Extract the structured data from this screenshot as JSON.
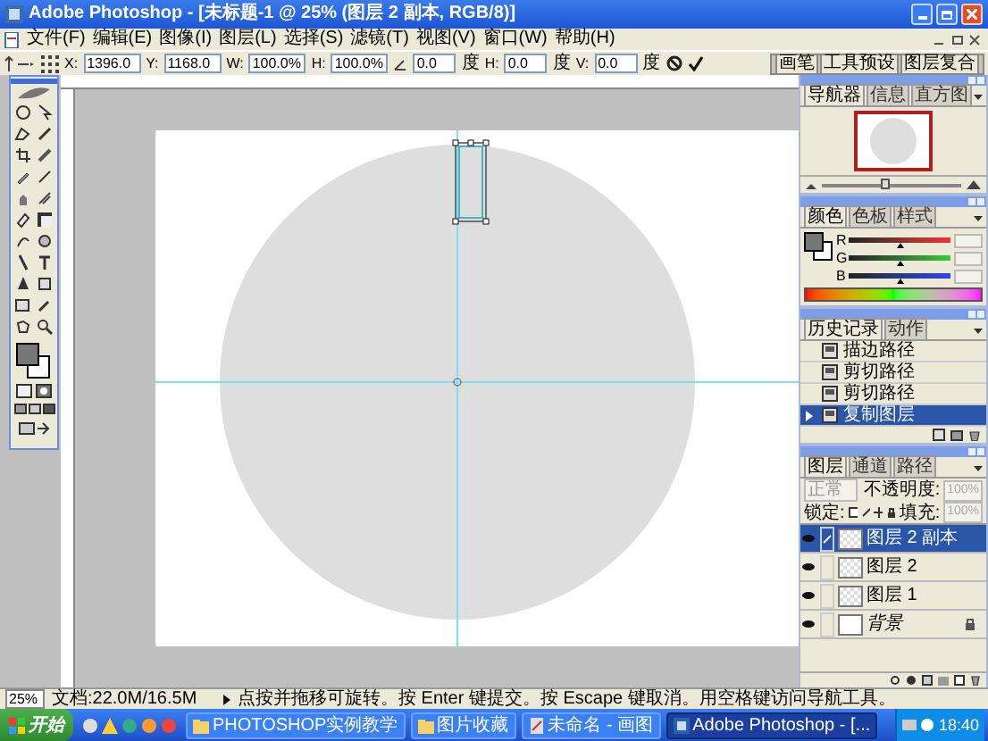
{
  "window": {
    "title": "Adobe Photoshop - [未标题-1 @ 25% (图层 2 副本, RGB/8)]"
  },
  "menu": [
    "文件(F)",
    "编辑(E)",
    "图像(I)",
    "图层(L)",
    "选择(S)",
    "滤镜(T)",
    "视图(V)",
    "窗口(W)",
    "帮助(H)"
  ],
  "options_bar": {
    "fields": [
      {
        "label": "X:",
        "value": "1396.0"
      },
      {
        "label": "Y:",
        "value": "1168.0"
      },
      {
        "label": "W:",
        "value": "100.0%"
      },
      {
        "label": "H:",
        "value": "100.0%"
      },
      {
        "value": "0.0",
        "unit": "度"
      },
      {
        "label": "H:",
        "value": "0.0",
        "unit": "度"
      },
      {
        "label": "V:",
        "value": "0.0",
        "unit": "度"
      }
    ],
    "palette_well_tabs": [
      "画笔",
      "工具预设",
      "图层复合"
    ]
  },
  "navigator": {
    "tabs": [
      {
        "label": "导航器",
        "selected": true
      },
      {
        "label": "信息",
        "selected": false
      },
      {
        "label": "直方图",
        "selected": false
      }
    ],
    "zoom_slider": {
      "level": 0.45
    }
  },
  "color": {
    "tabs": [
      {
        "label": "颜色",
        "selected": true
      },
      {
        "label": "色板",
        "selected": false
      },
      {
        "label": "样式",
        "selected": false
      }
    ],
    "channels": [
      {
        "label": "R",
        "level": 0.5
      },
      {
        "label": "G",
        "level": 0.5
      },
      {
        "label": "B",
        "level": 0.5
      }
    ]
  },
  "history": {
    "tabs": [
      {
        "label": "历史记录",
        "selected": true
      },
      {
        "label": "动作",
        "selected": false
      }
    ],
    "items": [
      {
        "label": "描边路径",
        "selected": false
      },
      {
        "label": "剪切路径",
        "selected": false
      },
      {
        "label": "剪切路径",
        "selected": false
      },
      {
        "label": "复制图层",
        "selected": true
      }
    ]
  },
  "layers": {
    "tabs": [
      {
        "label": "图层",
        "selected": true
      },
      {
        "label": "通道",
        "selected": false
      },
      {
        "label": "路径",
        "selected": false
      }
    ],
    "blend_mode": "正常",
    "opacity_label": "不透明度:",
    "opacity": "100%",
    "lock_label": "锁定:",
    "fill_label": "填充:",
    "fill": "100%",
    "items": [
      {
        "name": "图层 2 副本",
        "kind": "layer",
        "selected": true,
        "visible": true
      },
      {
        "name": "图层 2",
        "kind": "layer",
        "selected": false,
        "visible": true
      },
      {
        "name": "图层 1",
        "kind": "layer",
        "selected": false,
        "visible": true
      },
      {
        "name": "背景",
        "kind": "background",
        "selected": false,
        "visible": true
      }
    ]
  },
  "status_bar": {
    "zoom": "25%",
    "document": "文档:22.0M/16.5M",
    "hint": "点按并拖移可旋转。按 Enter 键提交。按 Escape 键取消。用空格键访问导航工具。"
  },
  "taskbar": {
    "start": "开始",
    "items": [
      {
        "label": "PHOTOSHOP实例教学",
        "kind": "folder",
        "selected": false
      },
      {
        "label": "图片收藏",
        "kind": "folder",
        "selected": false
      },
      {
        "label": "未命名 - 画图",
        "kind": "paint",
        "selected": false
      },
      {
        "label": "Adobe Photoshop - [...",
        "kind": "app",
        "selected": true
      }
    ],
    "clock": "18:40"
  }
}
